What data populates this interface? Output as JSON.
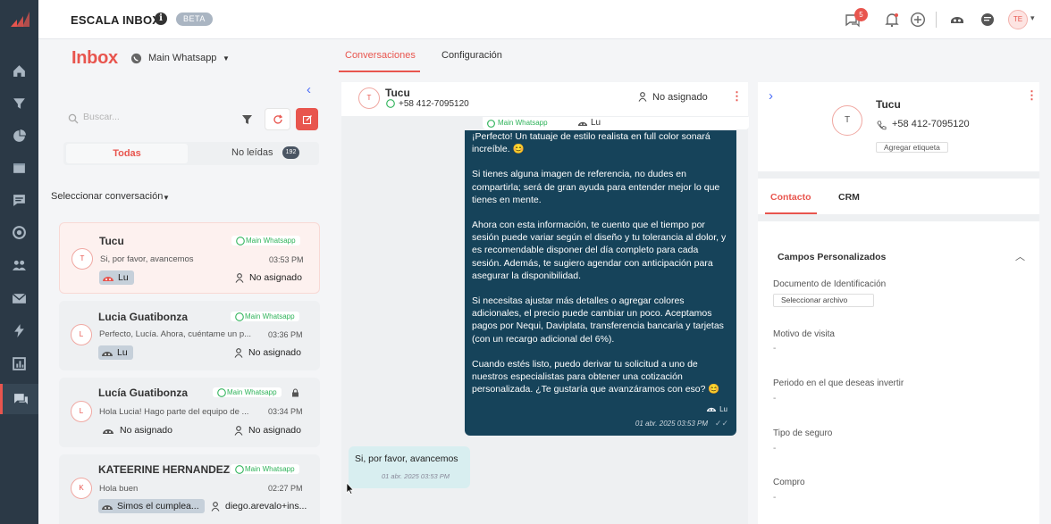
{
  "app": {
    "title": "ESCALA INBOX",
    "info_icon": "info-icon",
    "beta": "BETA",
    "brand_color": "#e8554e"
  },
  "topbar": {
    "notifications_count": "5",
    "user_initials": "TE"
  },
  "sidebar": {
    "icons": [
      "home-icon",
      "filter-icon",
      "pie-chart-icon",
      "folder-icon",
      "message-icon",
      "target-icon",
      "users-icon",
      "mail-icon",
      "bolt-icon",
      "chart-icon",
      "chat-icon"
    ]
  },
  "left": {
    "title": "Inbox",
    "channel": "Main Whatsapp",
    "search_placeholder": "Buscar...",
    "tab_all": "Todas",
    "tab_unread": "No leídas",
    "unread_count": "192",
    "select_conv": "Seleccionar conversación",
    "conversations": [
      {
        "initial": "T",
        "name": "Tucu",
        "channel": "Main Whatsapp",
        "preview": "Si, por favor, avancemos",
        "time": "03:53 PM",
        "tag": "Lu",
        "assigned": "No asignado"
      },
      {
        "initial": "L",
        "name": "Lucia Guatibonza",
        "channel": "Main Whatsapp",
        "preview": "Perfecto, Lucía. Ahora, cuéntame un p...",
        "time": "03:36 PM",
        "tag": "Lu",
        "assigned": "No asignado"
      },
      {
        "initial": "L",
        "name": "Lucía Guatibonza",
        "channel": "Main Whatsapp",
        "preview": "Hola Lucia! Hago parte del equipo de ...",
        "time": "03:34 PM",
        "tag": "No asignado",
        "assigned": "No asignado"
      },
      {
        "initial": "K",
        "name": "KATEERINE HERNANDEZ",
        "channel": "Main Whatsapp",
        "preview": "Hola buen",
        "time": "02:27 PM",
        "tag": "Simos el cumplea...",
        "assigned": "diego.arevalo+ins..."
      }
    ]
  },
  "center": {
    "tabs": [
      "Conversaciones",
      "Configuración"
    ],
    "contact": {
      "initial": "T",
      "name": "Tucu",
      "phone": "+58 412-7095120",
      "assigned": "No asignado"
    },
    "sub_channel": "Main Whatsapp",
    "sub_agent": "Lu",
    "outgoing": {
      "paragraphs": [
        "¡Perfecto! Un tatuaje de estilo realista en full color sonará increíble. 😊",
        "Si tienes alguna imagen de referencia, no dudes en compartirla; será de gran ayuda para entender mejor lo que tienes en mente.",
        "Ahora con esta información, te cuento que el tiempo por sesión puede variar según el diseño y tu tolerancia al dolor, y es recomendable disponer del día completo para cada sesión. Además, te sugiero agendar con anticipación para asegurar la disponibilidad.",
        "Si necesitas ajustar más detalles o agregar colores adicionales, el precio puede cambiar un poco. Aceptamos pagos por Nequi, Daviplata, transferencia bancaria y tarjetas (con un recargo adicional del 6%).",
        "Cuando estés listo, puedo derivar tu solicitud a uno de nuestros especialistas para obtener una cotización personalizada. ¿Te gustaría que avanzáramos con eso? 😊"
      ],
      "agent": "Lu",
      "time": "01 abr. 2025 03:53 PM"
    },
    "incoming": {
      "text": "Si, por favor, avancemos",
      "time": "01 abr. 2025 03:53 PM"
    }
  },
  "right": {
    "initial": "T",
    "name": "Tucu",
    "phone": "+58 412-7095120",
    "tag_button": "Agregar etiqueta",
    "tabs": [
      "Contacto",
      "CRM"
    ],
    "custom_fields_title": "Campos Personalizados",
    "fields": [
      {
        "label": "Documento de Identificación",
        "value": "Seleccionar archivo"
      },
      {
        "label": "Motivo de visita",
        "value": "-"
      },
      {
        "label": "Periodo en el que deseas invertir",
        "value": "-"
      },
      {
        "label": "Tipo de seguro",
        "value": "-"
      },
      {
        "label": "Compro",
        "value": "-"
      }
    ]
  }
}
